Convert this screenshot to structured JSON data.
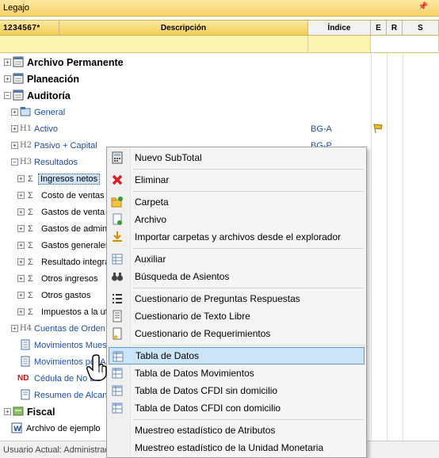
{
  "window": {
    "title": "Legajo",
    "pin_glyph": "†",
    "close_glyph": "×"
  },
  "grid": {
    "headers": {
      "levels": "1234567*",
      "description": "Descripción",
      "index": "Índice",
      "e": "E",
      "r": "R",
      "s": "S"
    }
  },
  "tree": [
    {
      "label": "Archivo Permanente",
      "icon": "folder-stack-icon"
    },
    {
      "label": "Planeación",
      "icon": "folder-stack-icon"
    },
    {
      "label": "Auditoría",
      "icon": "folder-stack-icon"
    },
    {
      "label": "General",
      "icon": "folder-icon"
    },
    {
      "code": "H1",
      "label": "Activo",
      "index": "BG-A",
      "icon": "flag-icon"
    },
    {
      "code": "H2",
      "label": "Pasivo + Capital",
      "index": "BG-P"
    },
    {
      "code": "H3",
      "label": "Resultados"
    },
    {
      "label": "Ingresos netos",
      "icon": "sigma-icon"
    },
    {
      "label": "Costo de ventas",
      "icon": "sigma-icon"
    },
    {
      "label": "Gastos de venta",
      "icon": "sigma-icon"
    },
    {
      "label": "Gastos de admin",
      "icon": "sigma-icon"
    },
    {
      "label": "Gastos generales",
      "icon": "sigma-icon"
    },
    {
      "label": "Resultado integra",
      "icon": "sigma-icon"
    },
    {
      "label": "Otros ingresos",
      "icon": "sigma-icon"
    },
    {
      "label": "Otros gastos",
      "icon": "sigma-icon"
    },
    {
      "label": "Impuestos a la ut",
      "icon": "sigma-icon"
    },
    {
      "code": "H4",
      "label": "Cuentas de Orden"
    },
    {
      "label": "Movimientos Muest",
      "icon": "doc-icon"
    },
    {
      "label": "Movimientos por A",
      "icon": "doc-icon"
    },
    {
      "label": "Cédula de No De",
      "icon": "nd-icon",
      "badge": "ND"
    },
    {
      "label": "Resumen de Alcanc",
      "icon": "doc-icon"
    },
    {
      "label": "Fiscal",
      "icon": "folder-stack-icon"
    },
    {
      "label": "Archivo de ejemplo",
      "icon": "word-icon"
    }
  ],
  "status": {
    "text": "Usuario Actual: Administrador"
  },
  "context_menu": {
    "items": [
      {
        "label": "Nuevo SubTotal",
        "icon": "calculator-icon"
      },
      {
        "label": "Eliminar",
        "icon": "delete-icon"
      },
      {
        "label": "Carpeta",
        "icon": "folder-add-icon"
      },
      {
        "label": "Archivo",
        "icon": "file-add-icon"
      },
      {
        "label": "Importar carpetas y archivos desde el explorador",
        "icon": "import-icon"
      },
      {
        "label": "Auxiliar",
        "icon": "ledger-icon"
      },
      {
        "label": "Búsqueda de Asientos",
        "icon": "binoculars-icon"
      },
      {
        "label": "Cuestionario de Preguntas Respuestas",
        "icon": "list-icon"
      },
      {
        "label": "Cuestionario de Texto Libre",
        "icon": "text-doc-icon"
      },
      {
        "label": "Cuestionario de Requerimientos",
        "icon": "star-doc-icon"
      },
      {
        "label": "Tabla de Datos",
        "icon": "table-icon",
        "highlighted": true
      },
      {
        "label": "Tabla de Datos Movimientos",
        "icon": "table-icon"
      },
      {
        "label": "Tabla de Datos CFDI sin domicilio",
        "icon": "table-icon"
      },
      {
        "label": "Tabla de Datos CFDI con domicilio",
        "icon": "table-icon"
      },
      {
        "label": "Muestreo estadístico de Atributos",
        "icon": "none"
      },
      {
        "label": "Muestreo estadístico de la Unidad Monetaria",
        "icon": "none"
      }
    ]
  },
  "colors": {
    "header_gold": "#f3cc52",
    "filter_yellow": "#fcf3b0",
    "link_blue": "#1f4ea7",
    "highlight": "#cce4f7"
  }
}
